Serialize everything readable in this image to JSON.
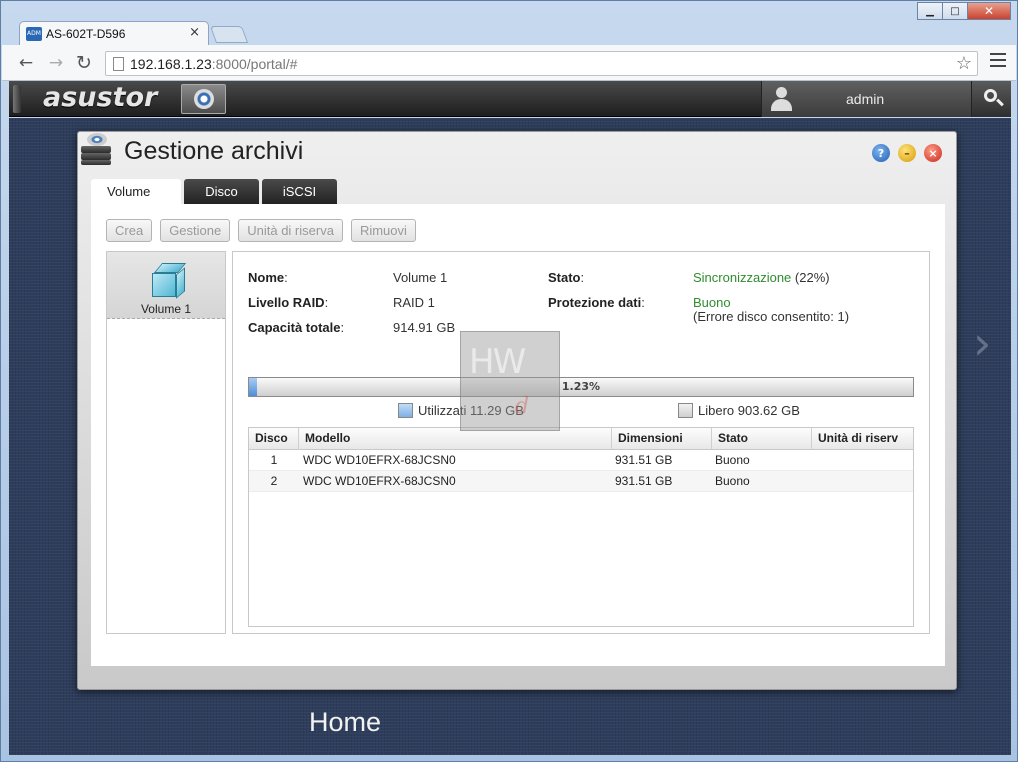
{
  "browser": {
    "tab_title": "AS-602T-D596",
    "tab_favicon": "ADM",
    "tab_close": "×",
    "url_host": "192.168.1.23",
    "url_rest": ":8000/portal/#",
    "window_minimize": "▁",
    "window_maximize": "□",
    "window_close": "✕",
    "back": "←",
    "forward": "→",
    "reload": "↻",
    "star": "☆"
  },
  "header": {
    "brand": "asustor",
    "user": "admin",
    "icons": [
      "storage-icon",
      "user-icon",
      "search-icon"
    ]
  },
  "window": {
    "title": "Gestione archivi",
    "help": "?",
    "minimize": "–",
    "close": "×",
    "tabs": [
      {
        "label": "Volume",
        "active": true
      },
      {
        "label": "Disco",
        "active": false
      },
      {
        "label": "iSCSI",
        "active": false
      }
    ],
    "actions": [
      "Crea",
      "Gestione",
      "Unità di riserva",
      "Rimuovi"
    ]
  },
  "volumes": [
    {
      "label": "Volume 1",
      "icon": "volume-cube-icon"
    }
  ],
  "details": {
    "name_label": "Nome",
    "name_value": "Volume 1",
    "raid_label": "Livello RAID",
    "raid_value": "RAID 1",
    "capacity_label": "Capacità totale",
    "capacity_value": "914.91 GB",
    "status_label": "Stato",
    "status_value": "Sincronizzazione",
    "status_progress": "(22%)",
    "protection_label": "Protezione dati",
    "protection_value": "Buono",
    "protection_note": "(Errore disco consentito: 1)",
    "colon": ":"
  },
  "usage": {
    "percent_used": 1.23,
    "percent_text": "1.23%",
    "used_label": "Utilizzati 11.29 GB",
    "free_label": "Libero 903.62 GB"
  },
  "watermark": {
    "text1": "HW",
    "text2": "d"
  },
  "disk_table": {
    "columns": [
      "Disco",
      "Modello",
      "Dimensioni",
      "Stato",
      "Unità di riserv"
    ],
    "rows": [
      [
        "1",
        "WDC WD10EFRX-68JCSN0",
        "931.51 GB",
        "Buono",
        ""
      ],
      [
        "2",
        "WDC WD10EFRX-68JCSN0",
        "931.51 GB",
        "Buono",
        ""
      ]
    ]
  },
  "desktop": {
    "label": "Home",
    "arrow": "›"
  },
  "colors": {
    "desktop_bg": "#2d3d5b",
    "status_green": "#2f8c2f",
    "usage_fill": "#4d8fd8"
  }
}
